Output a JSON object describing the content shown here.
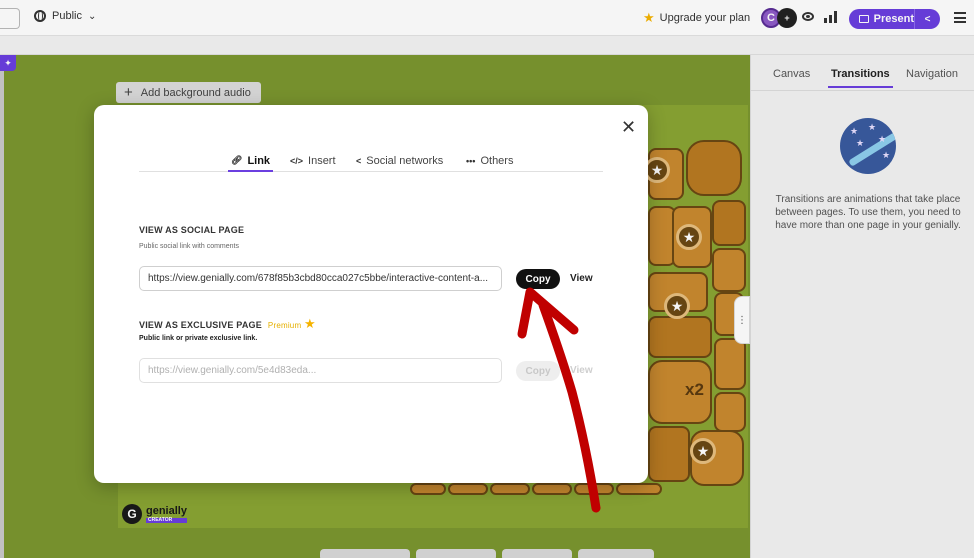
{
  "topbar": {
    "visibility_label": "Public",
    "upgrade_label": "Upgrade your plan",
    "avatar_initial": "C",
    "present_label": "Present"
  },
  "canvas": {
    "audio_button_label": "Add background audio",
    "board_badge": "x2",
    "logo_text": "genially",
    "logo_subtext": "CREATOR"
  },
  "right_panel": {
    "tabs": [
      "Canvas",
      "Transitions",
      "Navigation"
    ],
    "active_tab": "Transitions",
    "description": "Transitions are animations that take place between pages. To use them, you need to have more than one page in your genially."
  },
  "modal": {
    "tabs": [
      {
        "label": "Link",
        "icon": "link-icon",
        "active": true
      },
      {
        "label": "Insert",
        "icon": "code-icon",
        "active": false
      },
      {
        "label": "Social networks",
        "icon": "share-icon",
        "active": false
      },
      {
        "label": "Others",
        "icon": "more-icon",
        "active": false
      }
    ],
    "social": {
      "title": "VIEW AS SOCIAL PAGE",
      "subtitle": "Public social link with comments",
      "url": "https://view.genially.com/678f85b3cbd80cca027c5bbe/interactive-content-a...",
      "copy_label": "Copy",
      "view_label": "View"
    },
    "exclusive": {
      "title": "VIEW AS EXCLUSIVE PAGE",
      "premium_label": "Premium",
      "subtitle": "Public link or private exclusive link.",
      "url_placeholder": "https://view.genially.com/5e4d83eda...",
      "copy_label": "Copy",
      "view_label": "View"
    }
  },
  "colors": {
    "accent": "#6b3fe0",
    "annotation_arrow": "#c00000",
    "canvas_green": "#7b962f",
    "tile_brown": "#c98a2f"
  }
}
